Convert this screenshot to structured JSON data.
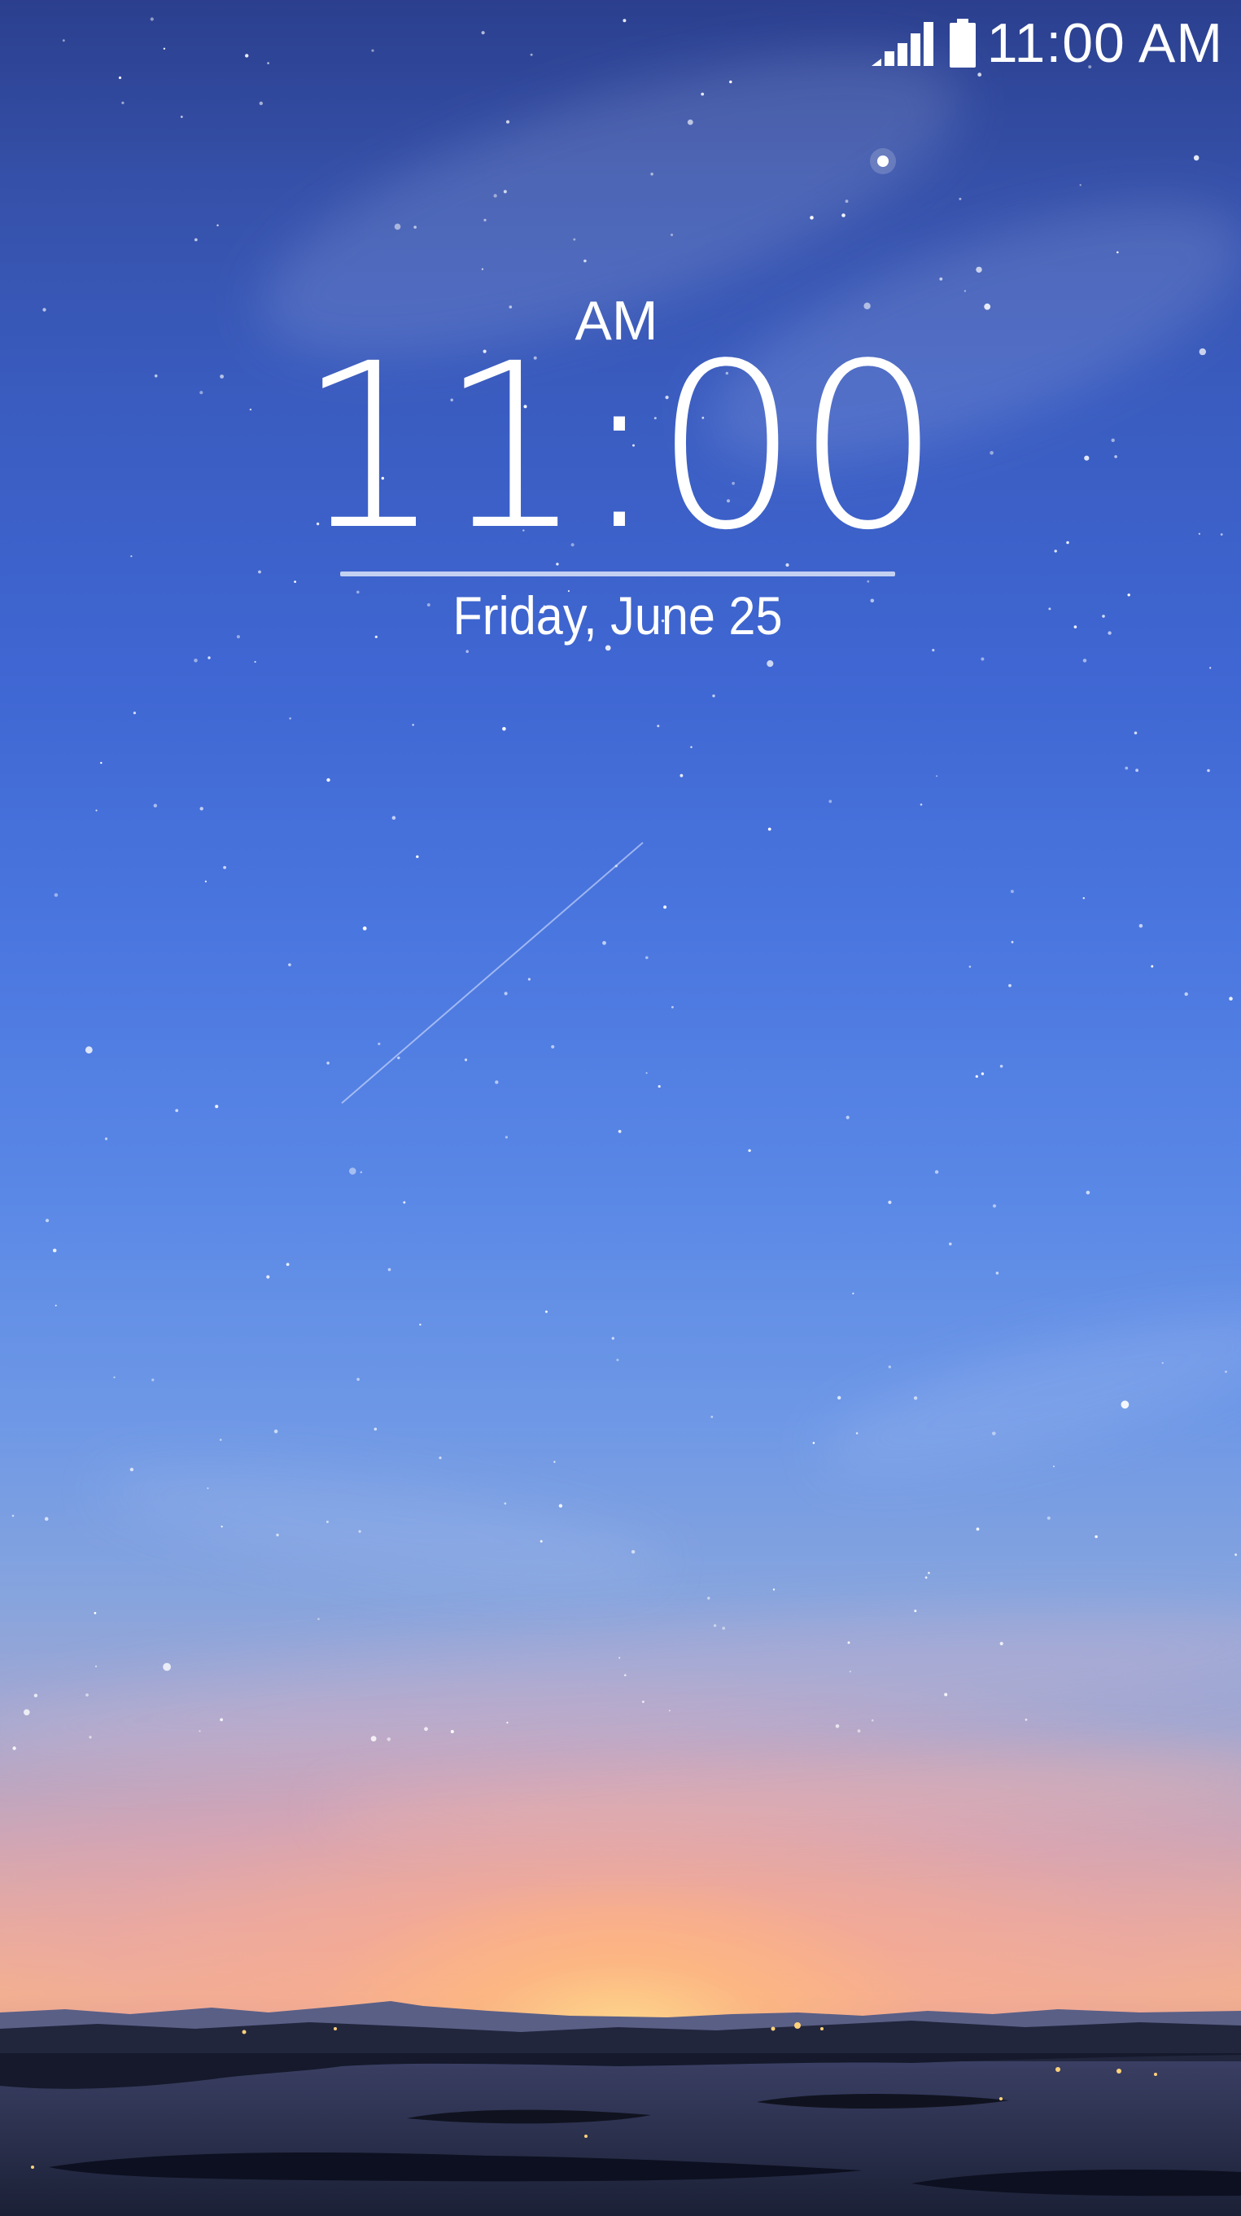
{
  "status_bar": {
    "time": "11:00 AM",
    "signal_icon": "signal-bars-icon",
    "battery_icon": "battery-full-icon"
  },
  "lock_clock": {
    "ampm": "AM",
    "time": "11:00",
    "date": "Friday, June 25"
  },
  "wallpaper": {
    "description_icon": "night-sky-wallpaper",
    "sky_top_color": "#2b3f8e",
    "sky_mid_color": "#4a76df",
    "horizon_glow_color": "#f3b48a"
  }
}
